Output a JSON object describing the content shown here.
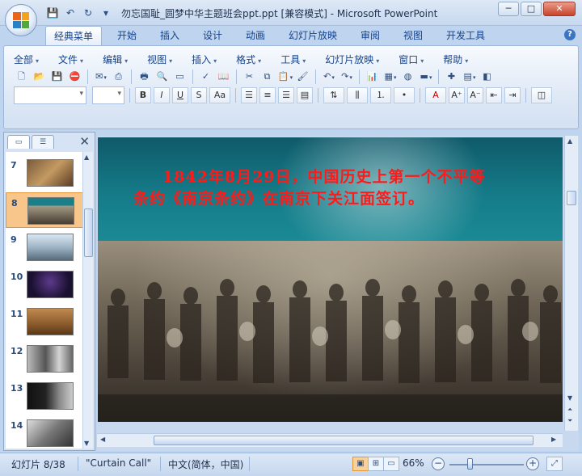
{
  "window": {
    "title": "勿忘国耻_圆梦中华主题班会ppt.ppt [兼容模式] - Microsoft PowerPoint",
    "controls": {
      "minimize": "─",
      "maximize": "□",
      "close": "✕"
    }
  },
  "qat": {
    "save": "💾",
    "undo": "↶",
    "redo": "↻",
    "customize": "▾"
  },
  "ribbon_tabs": [
    "经典菜单",
    "开始",
    "插入",
    "设计",
    "动画",
    "幻灯片放映",
    "审阅",
    "视图",
    "开发工具"
  ],
  "active_tab": "经典菜单",
  "classic_menu": [
    "全部",
    "文件",
    "编辑",
    "视图",
    "插入",
    "格式",
    "工具",
    "幻灯片放映",
    "窗口",
    "帮助"
  ],
  "toolbar": {
    "font_name": "",
    "font_size": ""
  },
  "slides_pane": {
    "tabs": [
      "slides",
      "outline"
    ],
    "thumbnails": [
      {
        "num": "7",
        "label": ""
      },
      {
        "num": "8",
        "label": ""
      },
      {
        "num": "9",
        "label": ""
      },
      {
        "num": "10",
        "label": ""
      },
      {
        "num": "11",
        "label": ""
      },
      {
        "num": "12",
        "label": ""
      },
      {
        "num": "13",
        "label": ""
      },
      {
        "num": "14",
        "label": ""
      }
    ],
    "selected": "8"
  },
  "slide": {
    "text": "1842年8月29日，中国历史上第一个不平等条约《南京条约》在南京下关江面签订。"
  },
  "statusbar": {
    "slide_info": "幻灯片 8/38",
    "theme": "\"Curtain Call\"",
    "language": "中文(简体，中国)",
    "zoom": "66%",
    "zoom_level_percent": 66
  },
  "colors": {
    "slide_text": "#ff1a1a",
    "accent": "#15428b",
    "selection": "#f8c58a"
  }
}
